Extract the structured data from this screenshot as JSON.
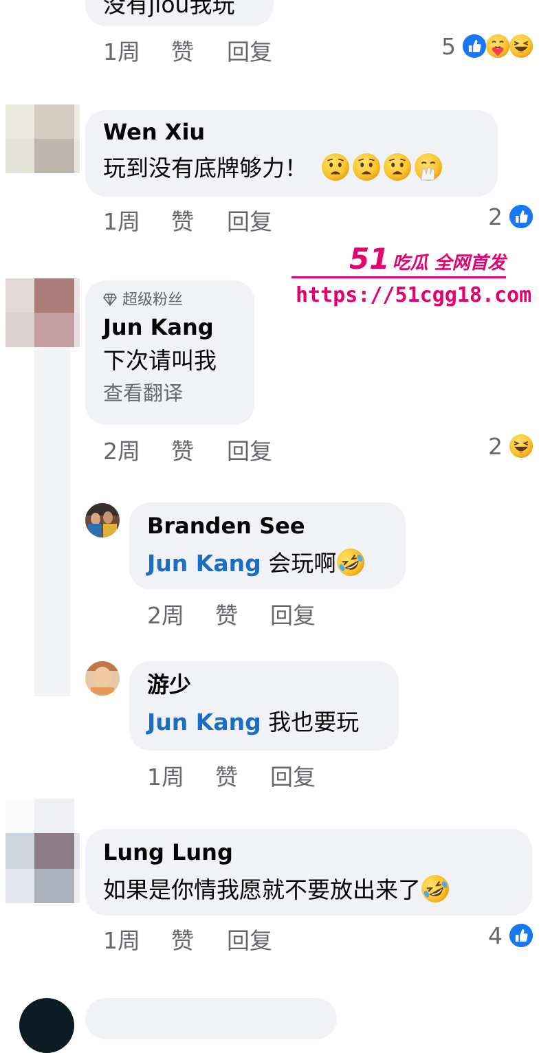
{
  "comments": [
    {
      "text_partial": "没有jiou我玩",
      "time": "1周",
      "like_label": "赞",
      "reply_label": "回复",
      "reaction_count": "5",
      "reactions": [
        "like-reaction-icon",
        "care-reaction-icon",
        "haha-reaction-icon"
      ]
    },
    {
      "author": "Wen Xiu",
      "text": "玩到没有底牌够力！",
      "text_emojis": [
        "worried-face-icon",
        "worried-face-icon",
        "worried-face-icon",
        "face-with-hand-over-mouth-icon"
      ],
      "time": "1周",
      "like_label": "赞",
      "reply_label": "回复",
      "reaction_count": "2",
      "reactions": [
        "like-reaction-icon"
      ]
    },
    {
      "badge": "超级粉丝",
      "author": "Jun Kang",
      "text": "下次请叫我",
      "translate_label": "查看翻译",
      "time": "2周",
      "like_label": "赞",
      "reply_label": "回复",
      "reaction_count": "2",
      "reactions": [
        "haha-reaction-icon"
      ],
      "replies": [
        {
          "author": "Branden See",
          "mention": "Jun Kang",
          "text": "会玩啊",
          "text_emojis": [
            "rolling-on-floor-laughing-icon"
          ],
          "time": "2周",
          "like_label": "赞",
          "reply_label": "回复"
        },
        {
          "author": "游少",
          "mention": "Jun Kang",
          "text": "我也要玩",
          "time": "1周",
          "like_label": "赞",
          "reply_label": "回复"
        }
      ]
    },
    {
      "author": "Lung Lung",
      "text": "如果是你情我愿就不要放出来了",
      "text_emojis": [
        "rolling-on-floor-laughing-icon"
      ],
      "time": "1周",
      "like_label": "赞",
      "reply_label": "回复",
      "reaction_count": "4",
      "reactions": [
        "like-reaction-icon"
      ]
    }
  ],
  "watermark": {
    "brand_number": "51",
    "brand_text": "吃瓜 全网首发",
    "url": "https://51cgg18.com",
    "color": "#e5006e"
  },
  "colors": {
    "bubble": "#f0f2f5",
    "meta": "#65676b",
    "mention": "#1b6ec2",
    "like_blue": "#1877f2"
  }
}
